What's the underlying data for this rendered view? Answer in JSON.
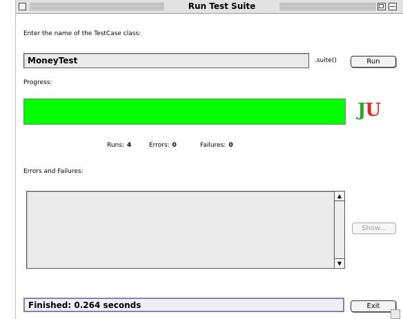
{
  "window": {
    "title": "Run Test Suite"
  },
  "test_class": {
    "prompt": "Enter the name of the TestCase class:",
    "value": "MoneyTest",
    "suffix": ".suite()",
    "run_label": "Run"
  },
  "progress": {
    "label": "Progress:",
    "fraction": 1.0,
    "color": "#00ff00"
  },
  "logo": {
    "j": "J",
    "u": "U",
    "j_color": "#2aa42a",
    "u_color": "#dc2a2a"
  },
  "stats": {
    "runs_label": "Runs:",
    "runs": "4",
    "errors_label": "Errors:",
    "errors": "0",
    "failures_label": "Failures:",
    "failures": "0"
  },
  "failures_list": {
    "label": "Errors and Failures:",
    "items": [],
    "show_label": "Show..."
  },
  "status": {
    "text": "Finished: 0.264 seconds",
    "exit_label": "Exit"
  }
}
